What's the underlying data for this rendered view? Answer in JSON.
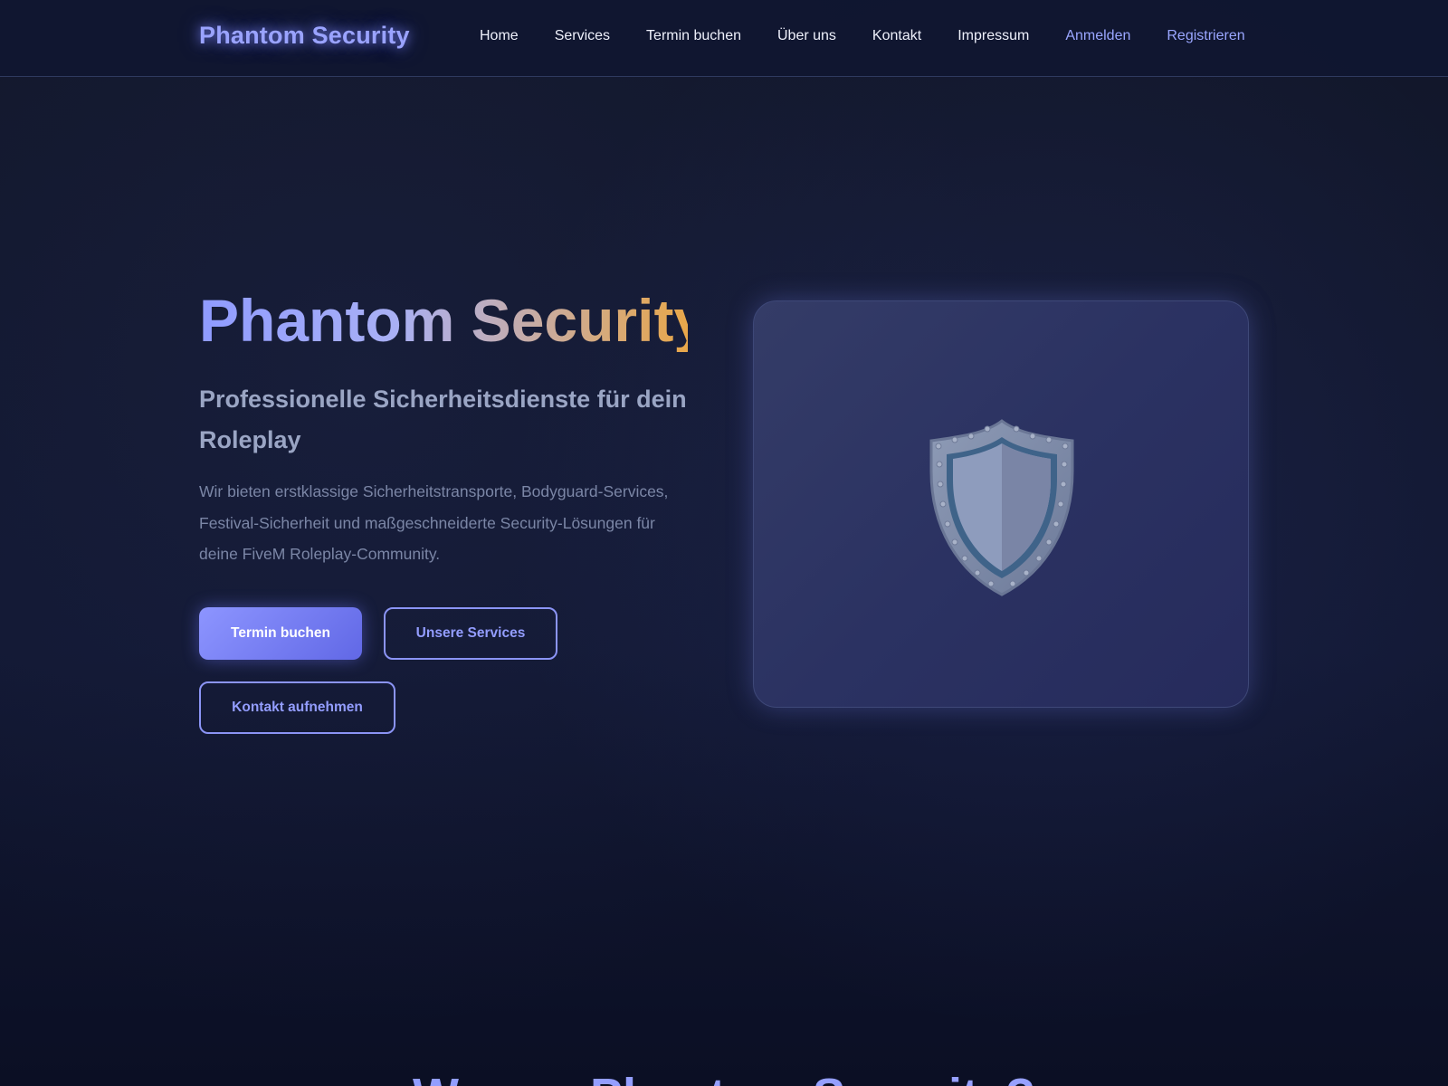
{
  "brand": {
    "name": "Phantom Security",
    "accent": "#9aa3ff"
  },
  "nav": {
    "items": [
      {
        "label": "Home"
      },
      {
        "label": "Services"
      },
      {
        "label": "Termin buchen"
      },
      {
        "label": "Über uns"
      },
      {
        "label": "Kontakt"
      },
      {
        "label": "Impressum"
      }
    ],
    "login": "Anmelden",
    "register": "Registrieren"
  },
  "hero": {
    "title": "Phantom Security",
    "subtitle": "Professionelle Sicherheitsdienste für dein Roleplay",
    "description": "Wir bieten erstklassige Sicherheitstransporte, Bodyguard-Services, Festival-Sicherheit und maßgeschneiderte Security-Lösungen für deine FiveM Roleplay-Community.",
    "buttons": {
      "book": "Termin buchen",
      "services": "Unsere Services",
      "contact": "Kontakt aufnehmen"
    },
    "image_icon": "shield-icon"
  },
  "next_section": {
    "heading": "Warum Phantom Security?"
  },
  "colors": {
    "background": "#0f1426",
    "primary": "#7b83f5",
    "title_gradient_end": "#e8a74a"
  }
}
